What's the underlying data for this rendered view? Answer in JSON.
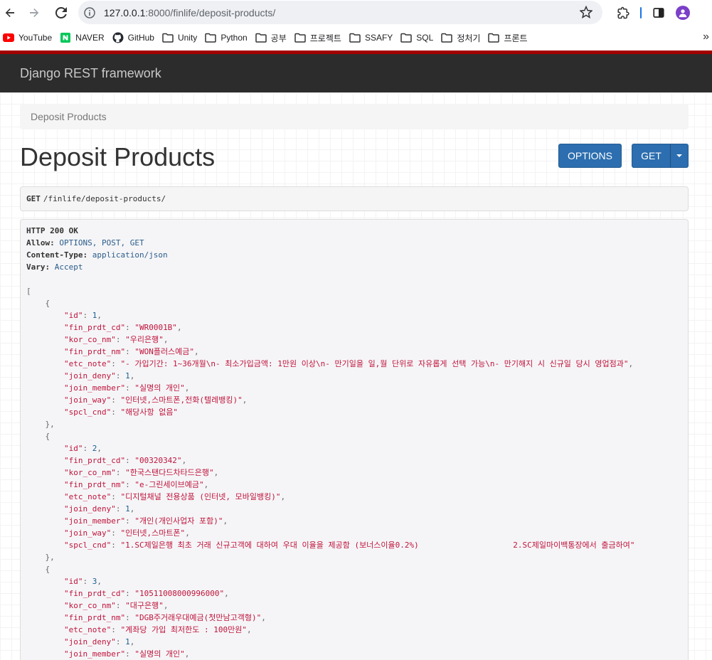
{
  "browser": {
    "url_host": "127.0.0.1",
    "url_rest": ":8000/finlife/deposit-products/",
    "bookmarks": [
      {
        "label": "YouTube",
        "icon": "youtube-icon"
      },
      {
        "label": "NAVER",
        "icon": "naver-icon"
      },
      {
        "label": "GitHub",
        "icon": "github-icon"
      },
      {
        "label": "Unity",
        "icon": "folder-icon"
      },
      {
        "label": "Python",
        "icon": "folder-icon"
      },
      {
        "label": "공부",
        "icon": "folder-icon"
      },
      {
        "label": "프로젝트",
        "icon": "folder-icon"
      },
      {
        "label": "SSAFY",
        "icon": "folder-icon"
      },
      {
        "label": "SQL",
        "icon": "folder-icon"
      },
      {
        "label": "정처기",
        "icon": "folder-icon"
      },
      {
        "label": "프론트",
        "icon": "folder-icon"
      }
    ],
    "more_label": "»"
  },
  "navbar": {
    "brand": "Django REST framework"
  },
  "breadcrumb": {
    "label": "Deposit Products"
  },
  "page": {
    "title": "Deposit Products",
    "options_label": "OPTIONS",
    "get_label": "GET"
  },
  "request": {
    "method": "GET",
    "path": "/finlife/deposit-products/"
  },
  "response": {
    "status": "HTTP 200 OK",
    "headers": [
      {
        "key": "Allow",
        "value": "OPTIONS, POST, GET"
      },
      {
        "key": "Content-Type",
        "value": "application/json"
      },
      {
        "key": "Vary",
        "value": "Accept"
      }
    ],
    "items": [
      {
        "id": 1,
        "fin_prdt_cd": "WR0001B",
        "kor_co_nm": "우리은행",
        "fin_prdt_nm": "WON플러스예금",
        "etc_note": "- 가입기간: 1~36개월\\n- 최소가입금액: 1만원 이상\\n- 만기일을 일,월 단위로 자유롭게 선택 가능\\n- 만기해지 시 신규일 당시 영업점과",
        "join_deny": 1,
        "join_member": "실명의 개인",
        "join_way": "인터넷,스마트폰,전화(텔레뱅킹)",
        "spcl_cnd": "해당사항 없음"
      },
      {
        "id": 2,
        "fin_prdt_cd": "00320342",
        "kor_co_nm": "한국스탠다드차타드은행",
        "fin_prdt_nm": "e-그린세이브예금",
        "etc_note": "디지털채널 전용상품 (인터넷, 모바일뱅킹)",
        "join_deny": 1,
        "join_member": "개인(개인사업자 포함)",
        "join_way": "인터넷,스마트폰",
        "spcl_cnd": "1.SC제일은행 최초 거래 신규고객에 대하여 우대 이율을 제공함 (보너스이율0.2%)                    2.SC제일마이백통장에서 출금하여"
      },
      {
        "id": 3,
        "fin_prdt_cd": "10511008000996000",
        "kor_co_nm": "대구은행",
        "fin_prdt_nm": "DGB주거래우대예금(첫만남고객형)",
        "etc_note": "계좌당 가입 최저한도 : 100만원",
        "join_deny": 1,
        "join_member": "실명의 개인"
      }
    ]
  }
}
